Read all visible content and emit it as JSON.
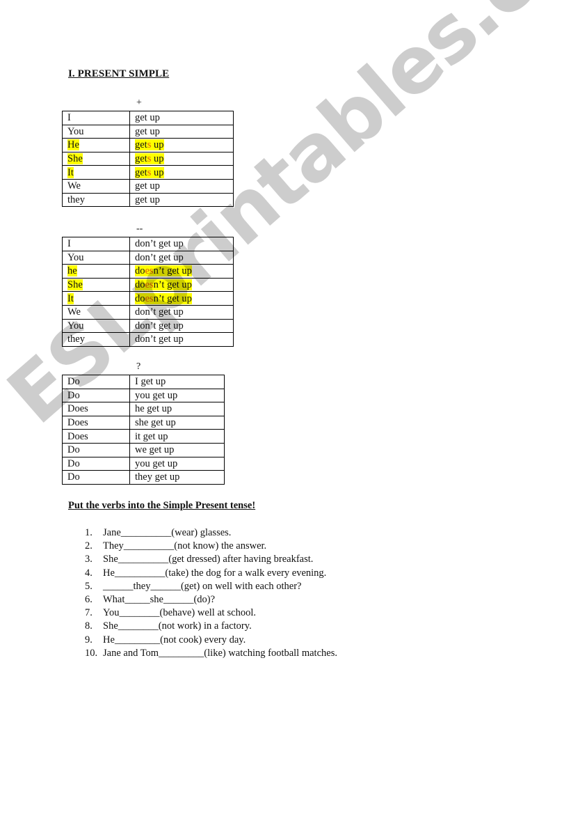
{
  "title": "I. PRESENT SIMPLE",
  "sections": {
    "affirmative": {
      "sign": "+",
      "rows": [
        {
          "subject": "I",
          "verb": "get up",
          "highlight": false
        },
        {
          "subject": "You",
          "verb": "get up",
          "highlight": false
        },
        {
          "subject": "He",
          "verb_pre": "get",
          "verb_mark": "s",
          "verb_post": " up",
          "highlight": true
        },
        {
          "subject": "She",
          "verb_pre": "get",
          "verb_mark": "s",
          "verb_post": " up",
          "highlight": true
        },
        {
          "subject": "It",
          "verb_pre": "get",
          "verb_mark": "s",
          "verb_post": " up",
          "highlight": true
        },
        {
          "subject": "We",
          "verb": "get up",
          "highlight": false
        },
        {
          "subject": "they",
          "verb": "get up",
          "highlight": false
        }
      ]
    },
    "negative": {
      "sign": "--",
      "rows": [
        {
          "subject": "I",
          "verb": "don’t get up",
          "highlight": false
        },
        {
          "subject": "You",
          "verb": "don’t get up",
          "highlight": false
        },
        {
          "subject": "he",
          "verb_pre": "do",
          "verb_mark": "es",
          "verb_post": "n’t get up",
          "highlight": true
        },
        {
          "subject": "She",
          "verb_pre": "do",
          "verb_mark": "es",
          "verb_post": "n’t get up",
          "highlight": true
        },
        {
          "subject": "It",
          "verb_pre": "do",
          "verb_mark": "es",
          "verb_post": "n’t get up",
          "highlight": true
        },
        {
          "subject": "We",
          "verb": "don’t get up",
          "highlight": false
        },
        {
          "subject": "You",
          "verb": "don’t get up",
          "highlight": false
        },
        {
          "subject": "they",
          "verb": "don’t get up",
          "highlight": false
        }
      ]
    },
    "question": {
      "sign": "?",
      "rows": [
        {
          "aux": "Do",
          "rest": "I get up"
        },
        {
          "aux": "Do",
          "rest": "you get up"
        },
        {
          "aux": "Does",
          "rest": "he get up"
        },
        {
          "aux": "Does",
          "rest": "she get up"
        },
        {
          "aux": "Does",
          "rest": "it get up"
        },
        {
          "aux": "Do",
          "rest": "we get up"
        },
        {
          "aux": "Do",
          "rest": "you get up"
        },
        {
          "aux": "Do",
          "rest": "they get up"
        }
      ]
    }
  },
  "exercise": {
    "instruction": "Put the verbs into the Simple Present tense!",
    "items": [
      {
        "num": "1.",
        "text": "Jane__________(wear) glasses."
      },
      {
        "num": "2.",
        "text": "They__________(not know) the answer."
      },
      {
        "num": "3.",
        "text": "She__________(get dressed) after having breakfast."
      },
      {
        "num": "4.",
        "text": "He__________(take) the dog for a walk every evening."
      },
      {
        "num": "5.",
        "text": "______they______(get) on well with each other?"
      },
      {
        "num": "6.",
        "text": "What_____she______(do)?"
      },
      {
        "num": "7.",
        "text": "You________(behave) well at school."
      },
      {
        "num": "8.",
        "text": "She________(not work) in a factory."
      },
      {
        "num": "9.",
        "text": "He_________(not cook) every day."
      },
      {
        "num": "10.",
        "text": "Jane and Tom_________(like) watching football matches."
      }
    ]
  },
  "watermark": "ESLprintables.com",
  "colors": {
    "highlight": "#ffff00",
    "ending_mark": "#e0560a",
    "watermark": "#c4c4c4"
  }
}
